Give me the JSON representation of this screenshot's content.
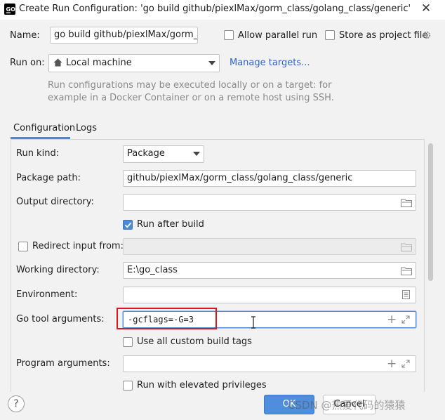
{
  "window": {
    "title": "Create Run Configuration: 'go build github/piexlMax/gorm_class/golang_class/generic'",
    "close_glyph": "✕"
  },
  "header": {
    "name_label": "Name:",
    "name_value": "go build github/piexlMax/gorm_class/golang_class/generic",
    "allow_parallel_label": "Allow parallel run",
    "store_project_label": "Store as project file",
    "run_on_label": "Run on:",
    "run_on_value": "Local machine",
    "manage_targets": "Manage targets...",
    "hint_line1": "Run configurations may be executed locally or on a target: for",
    "hint_line2": "example in a Docker Container or on a remote host using SSH."
  },
  "tabs": [
    {
      "label": "Configuration",
      "selected": true
    },
    {
      "label": "Logs",
      "selected": false
    }
  ],
  "config": {
    "run_kind_label": "Run kind:",
    "run_kind_value": "Package",
    "package_path_label": "Package path:",
    "package_path_value": "github/piexlMax/gorm_class/golang_class/generic",
    "output_dir_label": "Output directory:",
    "output_dir_value": "",
    "run_after_build_label": "Run after build",
    "run_after_build_checked": true,
    "redirect_input_label": "Redirect input from:",
    "redirect_input_checked": false,
    "working_dir_label": "Working directory:",
    "working_dir_value": "E:\\go_class",
    "environment_label": "Environment:",
    "environment_value": "",
    "go_tool_args_label": "Go tool arguments:",
    "go_tool_args_value": "-gcflags=-G=3",
    "custom_build_tags_label": "Use all custom build tags",
    "program_args_label": "Program arguments:",
    "program_args_value": "",
    "elevated_label": "Run with elevated privileges"
  },
  "footer": {
    "help_glyph": "?",
    "ok_label": "OK",
    "cancel_label": "Cancel"
  },
  "watermark": "CSDN @热爱代码的猿猿",
  "colors": {
    "accent": "#4a8ad8",
    "highlight_box": "#e0141b",
    "link": "#2f65ca"
  }
}
